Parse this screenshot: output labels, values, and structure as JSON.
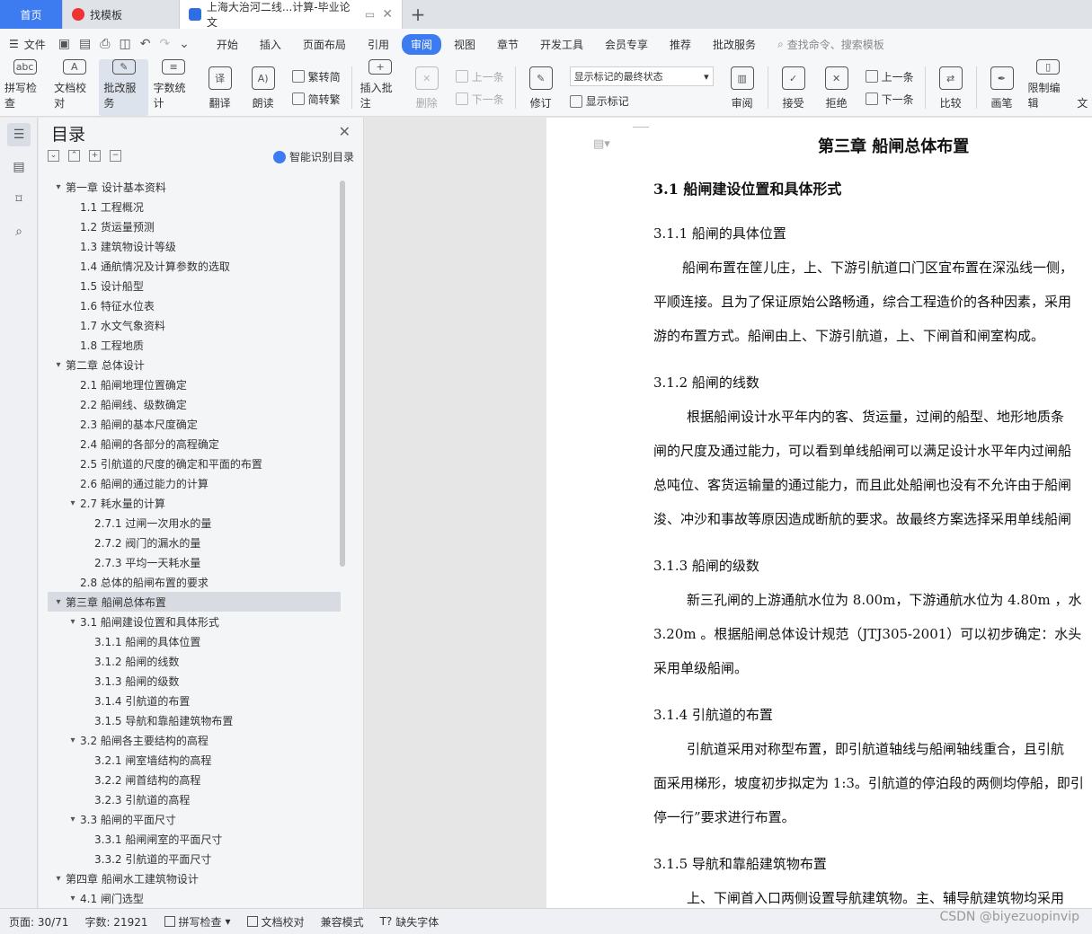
{
  "tabs": [
    {
      "label": "首页"
    },
    {
      "label": "找模板"
    },
    {
      "label": "上海大治河二线...计算-毕业论文"
    }
  ],
  "menu": {
    "file": "文件",
    "items": [
      "开始",
      "插入",
      "页面布局",
      "引用",
      "审阅",
      "视图",
      "章节",
      "开发工具",
      "会员专享",
      "推荐",
      "批改服务"
    ],
    "active_index": 4,
    "search": "查找命令、搜索模板"
  },
  "ribbon": {
    "spell": "拼写检查",
    "doccheck": "文档校对",
    "correct": "批改服务",
    "wordcount": "字数统计",
    "translate": "翻译",
    "read": "朗读",
    "trad": "繁转简",
    "simp": "简转繁",
    "insert_comment": "插入批注",
    "delete": "删除",
    "prev": "上一条",
    "next": "下一条",
    "revise": "修订",
    "markup_state": "显示标记的最终状态",
    "show_markup": "显示标记",
    "review": "审阅",
    "accept": "接受",
    "reject": "拒绝",
    "prev2": "上一条",
    "next2": "下一条",
    "compare": "比较",
    "pen": "画笔",
    "restrict": "限制编辑",
    "doc_more": "文"
  },
  "toc": {
    "title": "目录",
    "smart": "智能识别目录",
    "items": [
      {
        "text": "第一章  设计基本资料",
        "level": 1,
        "arrow": "⌄"
      },
      {
        "text": "1.1 工程概况",
        "level": 2
      },
      {
        "text": "1.2  货运量预测",
        "level": 2
      },
      {
        "text": "1.3  建筑物设计等级",
        "level": 2
      },
      {
        "text": "1.4  通航情况及计算参数的选取",
        "level": 2
      },
      {
        "text": "1.5  设计船型",
        "level": 2
      },
      {
        "text": "1.6  特征水位表",
        "level": 2
      },
      {
        "text": "1.7  水文气象资料",
        "level": 2
      },
      {
        "text": "1.8  工程地质",
        "level": 2
      },
      {
        "text": "第二章  总体设计",
        "level": 1,
        "arrow": "⌄"
      },
      {
        "text": "2.1  船闸地理位置确定",
        "level": 2
      },
      {
        "text": "2.2  船闸线、级数确定",
        "level": 2
      },
      {
        "text": "2.3  船闸的基本尺度确定",
        "level": 2
      },
      {
        "text": "2.4  船闸的各部分的高程确定",
        "level": 2
      },
      {
        "text": "2.5  引航道的尺度的确定和平面的布置",
        "level": 2
      },
      {
        "text": "2.6  船闸的通过能力的计算",
        "level": 2
      },
      {
        "text": "2.7  耗水量的计算",
        "level": 2,
        "arrow": "⌄"
      },
      {
        "text": "2.7.1  过闸一次用水的量",
        "level": 3
      },
      {
        "text": "2.7.2  阀门的漏水的量",
        "level": 3
      },
      {
        "text": "2.7.3  平均一天耗水量",
        "level": 3
      },
      {
        "text": "2.8  总体的船闸布置的要求",
        "level": 2
      },
      {
        "text": "第三章  船闸总体布置",
        "level": 1,
        "arrow": "⌄",
        "selected": true
      },
      {
        "text": "3.1 船闸建设位置和具体形式",
        "level": 2,
        "arrow": "⌄"
      },
      {
        "text": "3.1.1 船闸的具体位置",
        "level": 3
      },
      {
        "text": "3.1.2 船闸的线数",
        "level": 3
      },
      {
        "text": "3.1.3 船闸的级数",
        "level": 3
      },
      {
        "text": "3.1.4 引航道的布置",
        "level": 3
      },
      {
        "text": "3.1.5 导航和靠船建筑物布置",
        "level": 3
      },
      {
        "text": "3.2 船闸各主要结构的高程",
        "level": 2,
        "arrow": "⌄"
      },
      {
        "text": "3.2.1 闸室墙结构的高程",
        "level": 3
      },
      {
        "text": "3.2.2 闸首结构的高程",
        "level": 3
      },
      {
        "text": "3.2.3 引航道的高程",
        "level": 3
      },
      {
        "text": "3.3 船闸的平面尺寸",
        "level": 2,
        "arrow": "⌄"
      },
      {
        "text": "3.3.1 船闸闸室的平面尺寸",
        "level": 3
      },
      {
        "text": "3.3.2 引航道的平面尺寸",
        "level": 3
      },
      {
        "text": "第四章  船闸水工建筑物设计",
        "level": 1,
        "arrow": "⌄"
      },
      {
        "text": "4.1 闸门选型",
        "level": 2,
        "arrow": "⌄"
      }
    ]
  },
  "document": {
    "chapter": "第三章  船闸总体布置",
    "h31": "3.1 船闸建设位置和具体形式",
    "h311": "3.1.1 船闸的具体位置",
    "p311a": "船闸布置在筐儿庄，上、下游引航道口门区宜布置在深泓线一侧，",
    "p311b": "平顺连接。且为了保证原始公路畅通，综合工程造价的各种因素，采用",
    "p311c": "游的布置方式。船闸由上、下游引航道，上、下闸首和闸室构成。",
    "h312": "3.1.2 船闸的线数",
    "p312a": "根据船闸设计水平年内的客、货运量，过闸的船型、地形地质条",
    "p312b": "闸的尺度及通过能力，可以看到单线船闸可以满足设计水平年内过闸船",
    "p312c": "总吨位、客货运输量的通过能力，而且此处船闸也没有不允许由于船闸",
    "p312d": "浚、冲沙和事故等原因造成断航的要求。故最终方案选择采用单线船闸",
    "h313": "3.1.3 船闸的级数",
    "p313a": "新三孔闸的上游通航水位为 8.00m，下游通航水位为 4.80m ，水",
    "p313b": "3.20m  。根据船闸总体设计规范（JTJ305-2001）可以初步确定：水头",
    "p313c": "采用单级船闸。",
    "h314": "3.1.4 引航道的布置",
    "p314a": "引航道采用对称型布置，即引航道轴线与船闸轴线重合，且引航",
    "p314b": "面采用梯形，坡度初步拟定为 1:3。引航道的停泊段的两侧均停船，即引",
    "p314c": "停一行”要求进行布置。",
    "h315": "3.1.5 导航和靠船建筑物布置",
    "p315a": "上、下闸首入口两侧设置导航建筑物。主、辅导航建筑物均采用"
  },
  "status": {
    "page": "页面: 30/71",
    "words": "字数: 21921",
    "spell": "拼写检查",
    "doccheck": "文档校对",
    "compat": "兼容模式",
    "missing_font": "缺失字体"
  },
  "watermark": "CSDN @biyezuopinvip"
}
